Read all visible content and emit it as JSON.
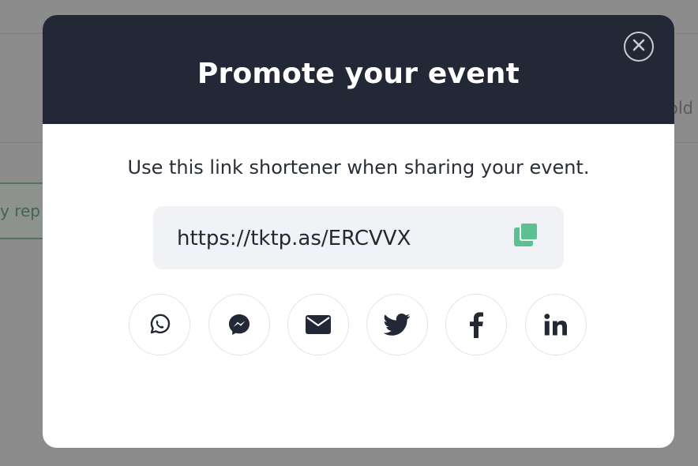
{
  "background": {
    "tab_partial_text": "y rep",
    "right_partial_text": "old"
  },
  "modal": {
    "title": "Promote your event",
    "subtitle": "Use this link shortener when sharing your event.",
    "short_link": "https://tktp.as/ERCVVX",
    "close_icon": "close-circle-icon",
    "copy_icon": "copy-icon",
    "share_buttons": [
      {
        "name": "whatsapp",
        "icon": "whatsapp-icon"
      },
      {
        "name": "messenger",
        "icon": "messenger-icon"
      },
      {
        "name": "email",
        "icon": "email-icon"
      },
      {
        "name": "twitter",
        "icon": "twitter-icon"
      },
      {
        "name": "facebook",
        "icon": "facebook-icon"
      },
      {
        "name": "linkedin",
        "icon": "linkedin-icon"
      }
    ]
  },
  "colors": {
    "header_bg": "#232836",
    "accent_green": "#5cc191",
    "text_dark": "#232836",
    "link_box_bg": "#f1f2f6"
  }
}
